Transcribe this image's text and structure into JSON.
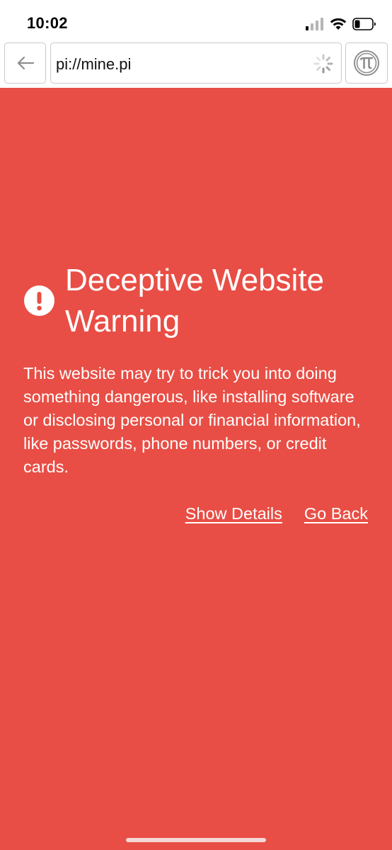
{
  "status_bar": {
    "time": "10:02"
  },
  "toolbar": {
    "back_icon": "arrow-left-icon",
    "url": "pi://mine.pi",
    "loading_icon": "loading-spinner-icon",
    "pi_icon": "pi-logo-icon"
  },
  "warning": {
    "title": "Deceptive Website Warning",
    "body": "This website may try to trick you into doing something dangerous, like installing software or disclosing personal or financial information, like passwords, phone numbers, or credit cards.",
    "show_details": "Show Details",
    "go_back": "Go Back",
    "icon": "exclamation-circle-icon"
  },
  "colors": {
    "warning_background": "#e84e45",
    "text": "#ffffff",
    "border": "#c9c9c9"
  }
}
